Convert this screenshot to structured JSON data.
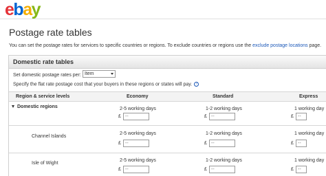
{
  "brand": {
    "letters": [
      {
        "char": "e",
        "color": "#e53238"
      },
      {
        "char": "b",
        "color": "#0064d2"
      },
      {
        "char": "a",
        "color": "#f5af02"
      },
      {
        "char": "y",
        "color": "#86b817"
      }
    ]
  },
  "page": {
    "title": "Postage rate tables",
    "intro_prefix": "You can set the postage rates for services to specific countries or regions. To exclude countries or regions use the",
    "intro_link": "exclude postage locations",
    "intro_suffix": "page."
  },
  "panel": {
    "title": "Domestic rate tables",
    "set_label": "Set domestic postage rates per:",
    "select_value": "Item",
    "specify_text": "Specify the flat rate postage cost that your buyers in these regions or states will pay.",
    "help_icon": "?"
  },
  "table": {
    "headers": {
      "region": "Region & service levels",
      "economy": "Economy",
      "standard": "Standard",
      "express": "Express"
    },
    "currency": "£",
    "price_placeholder": "--",
    "rows": [
      {
        "name": "Domestic regions",
        "economy_days": "2-5 working days",
        "standard_days": "1-2 working days",
        "express_days": "1 working day"
      },
      {
        "name": "Channel Islands",
        "economy_days": "2-5 working days",
        "standard_days": "1-2 working days",
        "express_days": "1 working day"
      },
      {
        "name": "Isle of Wight",
        "economy_days": "2-5 working days",
        "standard_days": "1-2 working days",
        "express_days": "1 working day"
      }
    ]
  }
}
